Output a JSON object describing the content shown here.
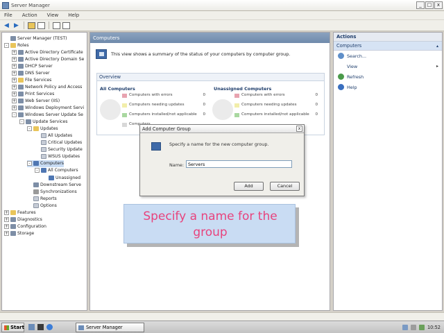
{
  "window": {
    "title": "Server Manager",
    "controls": [
      "_",
      "□",
      "x"
    ]
  },
  "menu": [
    "File",
    "Action",
    "View",
    "Help"
  ],
  "tree": [
    {
      "label": "Server Manager (TEST)",
      "level": 0,
      "exp": "",
      "icon": "srv"
    },
    {
      "label": "Roles",
      "level": 0,
      "exp": "-",
      "icon": "fold"
    },
    {
      "label": "Active Directory Certificate",
      "level": 1,
      "exp": "+",
      "icon": "srv"
    },
    {
      "label": "Active Directory Domain Se",
      "level": 1,
      "exp": "+",
      "icon": "srv"
    },
    {
      "label": "DHCP Server",
      "level": 1,
      "exp": "+",
      "icon": "srv"
    },
    {
      "label": "DNS Server",
      "level": 1,
      "exp": "+",
      "icon": "srv"
    },
    {
      "label": "File Services",
      "level": 1,
      "exp": "+",
      "icon": "fold"
    },
    {
      "label": "Network Policy and Access",
      "level": 1,
      "exp": "+",
      "icon": "srv"
    },
    {
      "label": "Print Services",
      "level": 1,
      "exp": "+",
      "icon": "srv"
    },
    {
      "label": "Web Server (IIS)",
      "level": 1,
      "exp": "+",
      "icon": "srv"
    },
    {
      "label": "Windows Deployment Servi",
      "level": 1,
      "exp": "+",
      "icon": "srv"
    },
    {
      "label": "Windows Server Update Se",
      "level": 1,
      "exp": "-",
      "icon": "srv"
    },
    {
      "label": "Update Services",
      "level": 2,
      "exp": "-",
      "icon": "srv"
    },
    {
      "label": "Updates",
      "level": 3,
      "exp": "-",
      "icon": "fold"
    },
    {
      "label": "All Updates",
      "level": 4,
      "exp": "",
      "icon": "doc"
    },
    {
      "label": "Critical Updates",
      "level": 4,
      "exp": "",
      "icon": "doc"
    },
    {
      "label": "Security Update",
      "level": 4,
      "exp": "",
      "icon": "doc"
    },
    {
      "label": "WSUS Updates",
      "level": 4,
      "exp": "",
      "icon": "doc"
    },
    {
      "label": "Computers",
      "level": 3,
      "exp": "-",
      "icon": "pc",
      "selected": true
    },
    {
      "label": "All Computers",
      "level": 4,
      "exp": "-",
      "icon": "pc"
    },
    {
      "label": "Unassigned",
      "level": 5,
      "exp": "",
      "icon": "pc"
    },
    {
      "label": "Downstream Serve",
      "level": 3,
      "exp": "",
      "icon": "srv"
    },
    {
      "label": "Synchronizations",
      "level": 3,
      "exp": "",
      "icon": "gear"
    },
    {
      "label": "Reports",
      "level": 3,
      "exp": "",
      "icon": "doc"
    },
    {
      "label": "Options",
      "level": 3,
      "exp": "",
      "icon": "doc"
    },
    {
      "label": "Features",
      "level": 0,
      "exp": "+",
      "icon": "fold"
    },
    {
      "label": "Diagnostics",
      "level": 0,
      "exp": "+",
      "icon": "srv"
    },
    {
      "label": "Configuration",
      "level": 0,
      "exp": "+",
      "icon": "srv"
    },
    {
      "label": "Storage",
      "level": 0,
      "exp": "+",
      "icon": "srv"
    }
  ],
  "content": {
    "header": "Computers",
    "summary": "This view shows a summary of the status of your computers by computer group.",
    "overview_title": "Overview",
    "left_title": "All Computers",
    "right_title": "Unassigned Computers",
    "stats": [
      {
        "label": "Computers with errors",
        "value": "0",
        "color": "#e8a3b0"
      },
      {
        "label": "Computers needing updates",
        "value": "0",
        "color": "#f2eeaa"
      },
      {
        "label": "Computers installed/not applicable",
        "value": "0",
        "color": "#a9d8a0"
      },
      {
        "label": "Computers",
        "value": "",
        "color": "#d8d8d8"
      }
    ],
    "right_stats": [
      {
        "label": "Computers with errors",
        "value": "0",
        "color": "#e8a3b0"
      },
      {
        "label": "Computers needing updates",
        "value": "0",
        "color": "#f2eeaa"
      },
      {
        "label": "Computers installed/not applicable",
        "value": "0",
        "color": "#a9d8a0"
      }
    ]
  },
  "actions": {
    "header": "Actions",
    "section": "Computers",
    "items": [
      {
        "label": "Search...",
        "icon": "search-icon",
        "arrow": ""
      },
      {
        "label": "View",
        "icon": "",
        "arrow": "▸"
      },
      {
        "label": "Refresh",
        "icon": "refresh-icon",
        "arrow": ""
      },
      {
        "label": "Help",
        "icon": "help-icon",
        "arrow": ""
      }
    ]
  },
  "dialog": {
    "title": "Add Computer Group",
    "close": "x",
    "prompt": "Specify a name for the new computer group.",
    "name_label": "Name:",
    "name_value": "Servers",
    "add_label": "Add",
    "cancel_label": "Cancel"
  },
  "callout": {
    "text": "Specify a name for the group"
  },
  "taskbar": {
    "start_label": "Start",
    "task_label": "Server Manager",
    "clock": "10:52"
  }
}
